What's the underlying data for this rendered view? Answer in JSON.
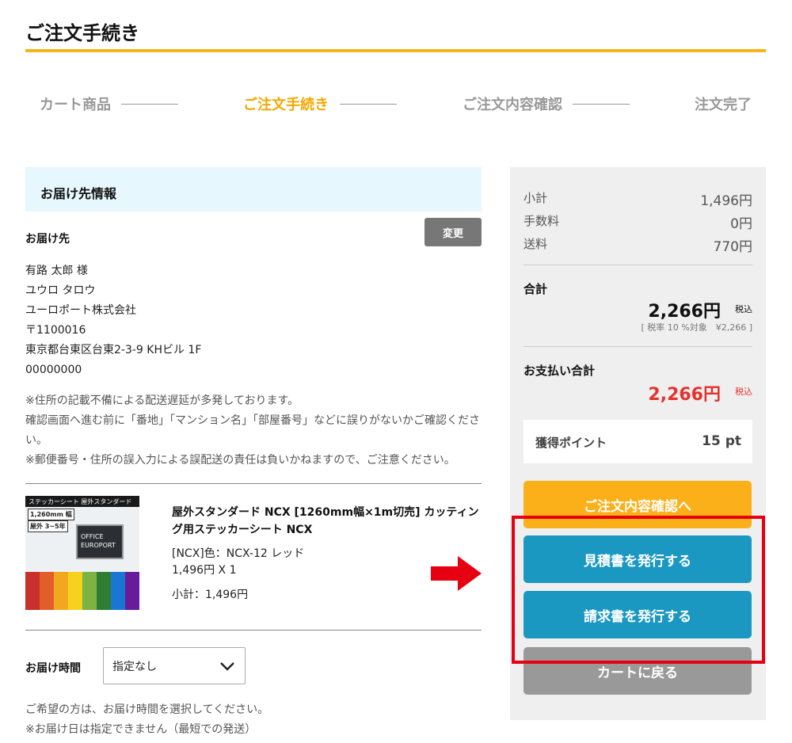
{
  "page": {
    "title": "ご注文手続き"
  },
  "steps": [
    {
      "label": "カート商品",
      "active": false
    },
    {
      "label": "ご注文手続き",
      "active": true
    },
    {
      "label": "ご注文内容確認",
      "active": false
    },
    {
      "label": "注文完了",
      "active": false
    }
  ],
  "delivery": {
    "section_title": "お届け先情報",
    "dest_label": "お届け先",
    "change_label": "変更",
    "address_lines": [
      "有路 太郎 様",
      "ユウロ タロウ",
      "ユーロポート株式会社",
      "〒1100016",
      "東京都台東区台東2-3-9 KHビル 1F",
      "00000000"
    ],
    "notes": [
      "※住所の記載不備による配送遅延が多発しております。",
      "確認画面へ進む前に「番地」「マンション名」「部屋番号」などに誤りがないかご確認ください。",
      "※郵便番号・住所の誤入力による誤配送の責任は負いかねますので、ご注意ください。"
    ]
  },
  "product": {
    "image_banner": "ステッカーシート 屋外スタンダード",
    "image_tag1": "1,260mm 幅",
    "image_tag2": "屋外 3~5年",
    "image_plate": "OFFICE EUROPORT",
    "name": "屋外スタンダード NCX [1260mm幅×1m切売] カッティング用ステッカーシート NCX",
    "option": "[NCX]色：NCX-12 レッド",
    "price_qty": "1,496円 X 1",
    "subtotal": "小計：1,496円",
    "roll_colors": [
      "#c9302c",
      "#e35d2a",
      "#f1a81e",
      "#f6d21f",
      "#7cb342",
      "#2e7d32",
      "#1976d2",
      "#6a1b9a"
    ]
  },
  "delivery_time": {
    "label": "お届け時間",
    "selected": "指定なし",
    "notes": [
      "ご希望の方は、お届け時間を選択してください。",
      "※お届け日は指定できません（最短での発送）"
    ]
  },
  "summary": {
    "subtotal_label": "小計",
    "subtotal_value": "1,496円",
    "fee_label": "手数料",
    "fee_value": "0円",
    "shipping_label": "送料",
    "shipping_value": "770円",
    "total_label": "合計",
    "total_value": "2,266円",
    "tax_tag": "税込",
    "tax_note": "[ 税率 10 %対象　¥2,266 ]",
    "payment_label": "お支払い合計",
    "payment_value": "2,266円",
    "payment_tax_tag": "税込",
    "points_label": "獲得ポイント",
    "points_value": "15 pt"
  },
  "buttons": {
    "confirm": "ご注文内容確認へ",
    "quote": "見積書を発行する",
    "invoice": "請求書を発行する",
    "back": "カートに戻る"
  },
  "colors": {
    "accent": "#f3b51a",
    "step_active": "#f2a900",
    "blue_button": "#1b98c2",
    "price_red": "#e5322d",
    "highlight": "#e60012"
  }
}
